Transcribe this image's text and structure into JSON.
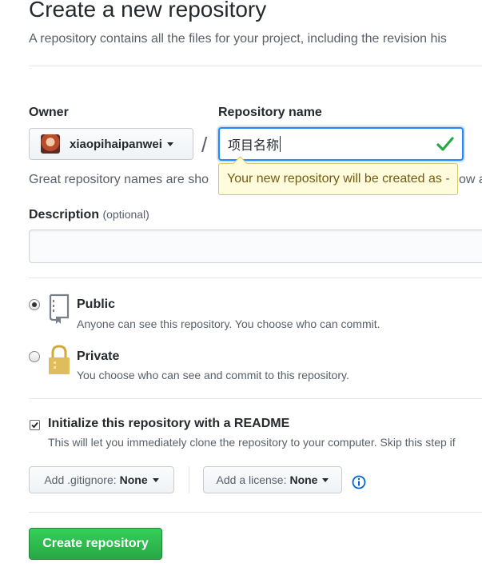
{
  "page": {
    "title": "Create a new repository",
    "subtitle": "A repository contains all the files for your project, including the revision his"
  },
  "owner": {
    "label": "Owner",
    "value": "xiaopihaipanwei"
  },
  "separator": "/",
  "repo_name": {
    "label": "Repository name",
    "value": "项目名称",
    "valid": true,
    "helper_text": "Great repository names are sho",
    "helper_tail": "ow a",
    "tooltip": "Your new repository will be created as -"
  },
  "description": {
    "label": "Description",
    "optional_note": "(optional)",
    "value": ""
  },
  "visibility": {
    "selected": "public",
    "options": [
      {
        "id": "public",
        "title": "Public",
        "note": "Anyone can see this repository. You choose who can commit.",
        "icon": "repo-book-icon"
      },
      {
        "id": "private",
        "title": "Private",
        "note": "You choose who can see and commit to this repository.",
        "icon": "lock-icon"
      }
    ]
  },
  "readme": {
    "checked": true,
    "title": "Initialize this repository with a README",
    "note": "This will let you immediately clone the repository to your computer. Skip this step if"
  },
  "gitignore": {
    "label": "Add .gitignore:",
    "value": "None"
  },
  "license": {
    "label": "Add a license:",
    "value": "None"
  },
  "submit": {
    "label": "Create repository"
  },
  "colors": {
    "accent_blue": "#2188ff",
    "success_green": "#28a745",
    "tooltip_bg": "#fffbdd",
    "muted_text": "#586069"
  }
}
